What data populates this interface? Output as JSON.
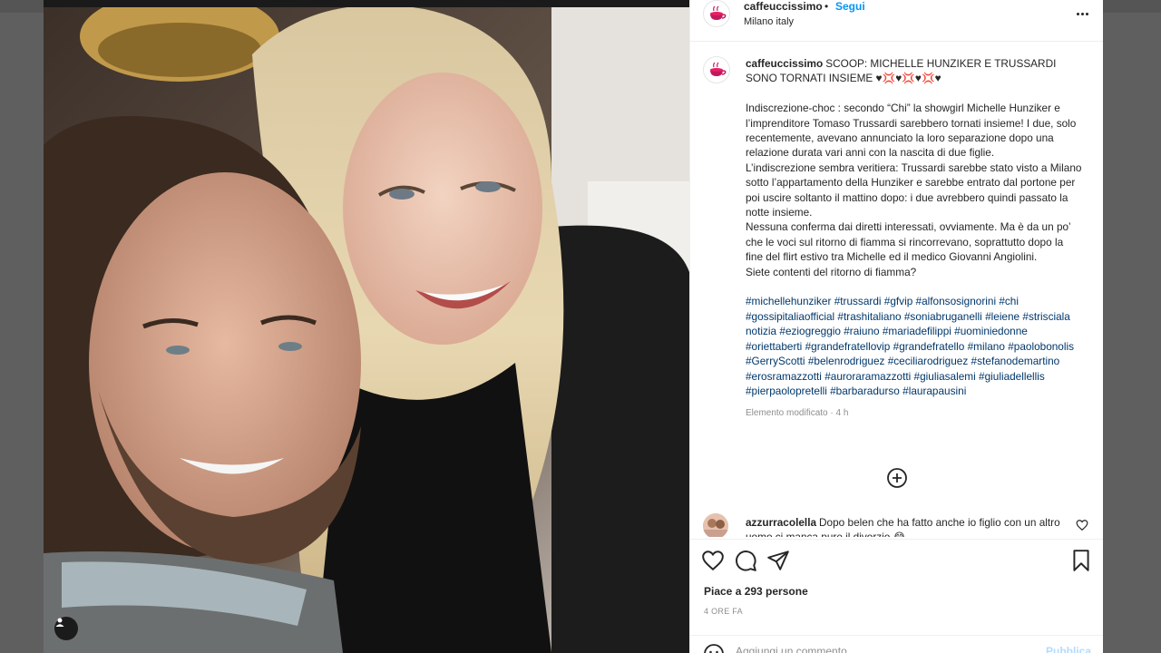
{
  "post": {
    "username": "caffeuccissimo",
    "separator": "•",
    "follow_label": "Segui",
    "location": "Milano italy",
    "more_icon": "more-horizontal-icon"
  },
  "caption": {
    "username": "caffeuccissimo",
    "headline": "SCOOP: MICHELLE HUNZIKER E TRUSSARDI SONO TORNATI INSIEME ♥💢♥💢♥💢♥",
    "paragraph1": "Indiscrezione-choc : secondo “Chi” la showgirl Michelle Hunziker e l’imprenditore Tomaso Trussardi sarebbero tornati insieme! I due, solo recentemente, avevano annunciato la loro separazione dopo una relazione durata vari anni con la nascita di due figlie.",
    "paragraph2": "L’indiscrezione sembra veritiera: Trussardi sarebbe stato visto a Milano sotto l’appartamento della Hunziker e sarebbe entrato dal portone per poi uscire soltanto il mattino dopo: i due avrebbero quindi passato la notte insieme.",
    "paragraph3": "Nessuna conferma dai diretti interessati, ovviamente. Ma è da un po’ che le voci sul ritorno di fiamma si rincorrevano, soprattutto dopo la fine del flirt estivo tra Michelle ed il medico Giovanni Angiolini.",
    "paragraph4": "Siete contenti del ritorno di fiamma?",
    "hashtags": "#michellehunziker #trussardi #gfvip #alfonsosignorini #chi #gossipitaliaofficial #trashitaliano #soniabruganelli #leiene #strisciala notizia #eziogreggio #raiuno #mariadefilippi #uominiedonne #oriettaberti #grandefratellovip #grandefratello #milano #paolobonolis #GerryScotti #belenrodriguez #ceciliarodriguez #stefanodemartino #erosramazzotti #auroraramazzotti #giuliasalemi #giuliadellellis #pierpaolopretelli #barbaradurso #laurapausini",
    "edited_label": "Elemento modificato · 4 h"
  },
  "comment": {
    "username": "azzurracolella",
    "text": "Dopo belen che ha fatto anche io figlio con un altro uomo ci manca pure il divorzio 😂"
  },
  "actions": {
    "likes": "Piace a 293 persone",
    "time": "4 ORE FA"
  },
  "add_comment": {
    "placeholder": "Aggiungi un commento...",
    "publish": "Pubblica"
  }
}
